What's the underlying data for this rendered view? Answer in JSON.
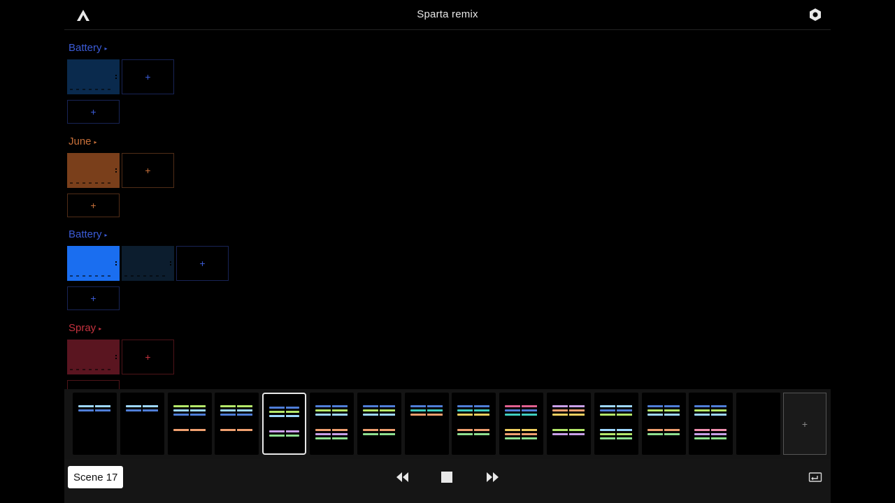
{
  "header": {
    "title": "Sparta remix",
    "logo_icon": "ableton-note-logo-icon",
    "settings_icon": "hexagon-settings-icon"
  },
  "tracks": [
    {
      "name": "Battery",
      "arrow": "▸",
      "color": "#3b5bd6",
      "clips": [
        {
          "fill": "#0a2a4d",
          "state": "dim"
        }
      ],
      "add_label": "+",
      "slot_add": "+"
    },
    {
      "name": "June",
      "arrow": "▸",
      "color": "#c8703a",
      "clips": [
        {
          "fill": "#7a3f1b",
          "state": "dim"
        }
      ],
      "add_label": "+",
      "slot_add": "+"
    },
    {
      "name": "Battery",
      "arrow": "▸",
      "color": "#3b5bd6",
      "clips": [
        {
          "fill": "#1a6ef0",
          "state": "active"
        },
        {
          "fill": "#0c1d2e",
          "state": "dim"
        }
      ],
      "add_label": "+",
      "slot_add": "+"
    },
    {
      "name": "Spray",
      "arrow": "▸",
      "color": "#c4323f",
      "clips": [
        {
          "fill": "#5a1520",
          "state": "dim"
        }
      ],
      "add_label": "+",
      "slot_add": "+"
    }
  ],
  "scenes": {
    "selected_index": 4,
    "add_label": "+",
    "items": [
      {
        "bars": [
          [
            "#9fd8ff",
            "#4f7ed8"
          ]
        ]
      },
      {
        "bars": [
          [
            "#9fd8ff",
            "#4f7ed8"
          ]
        ]
      },
      {
        "bars": [
          [
            "#b4e86a",
            "#9fd8ff",
            "#4f7ed8",
            "#f0a070"
          ]
        ]
      },
      {
        "bars": [
          [
            "#b4e86a",
            "#9fd8ff",
            "#4f7ed8",
            "#f0a070"
          ]
        ]
      },
      {
        "bars": [
          [
            "#4f7ed8",
            "#b4e86a",
            "#9fd8ff",
            "#c9a0e8",
            "#8fe090"
          ]
        ]
      },
      {
        "bars": [
          [
            "#4f7ed8",
            "#b4e86a",
            "#9fd8ff",
            "#f0a070",
            "#c9a0e8",
            "#8fe090"
          ]
        ]
      },
      {
        "bars": [
          [
            "#4f7ed8",
            "#b4e86a",
            "#9fd8ff",
            "#f0a070",
            "#8fe090"
          ]
        ]
      },
      {
        "bars": [
          [
            "#4f7ed8",
            "#40d0c0",
            "#f0a070"
          ]
        ]
      },
      {
        "bars": [
          [
            "#4f7ed8",
            "#40d0c0",
            "#f0d060",
            "#f0a070",
            "#8fe090"
          ]
        ]
      },
      {
        "bars": [
          [
            "#e06090",
            "#4f7ed8",
            "#40d0c0",
            "#f0d060",
            "#f0a070",
            "#8fe090"
          ]
        ]
      },
      {
        "bars": [
          [
            "#c9a0e8",
            "#f0a070",
            "#f0d060",
            "#b4e86a",
            "#c9a0e8"
          ]
        ]
      },
      {
        "bars": [
          [
            "#9fd8ff",
            "#4f7ed8",
            "#b4e86a",
            "#9fd8ff",
            "#b4e86a",
            "#8fe090"
          ]
        ]
      },
      {
        "bars": [
          [
            "#4f7ed8",
            "#b4e86a",
            "#9fd8ff",
            "#f0a070",
            "#8fe090"
          ]
        ]
      },
      {
        "bars": [
          [
            "#4f7ed8",
            "#b4e86a",
            "#9fd8ff",
            "#f090b0",
            "#c9a0e8",
            "#8fe090"
          ]
        ]
      },
      {
        "bars": [
          []
        ]
      }
    ]
  },
  "transport": {
    "scene_label": "Scene 17",
    "rewind_icon": "rewind-icon",
    "stop_icon": "stop-icon",
    "forward_icon": "fast-forward-icon",
    "route_icon": "loop-return-icon"
  }
}
